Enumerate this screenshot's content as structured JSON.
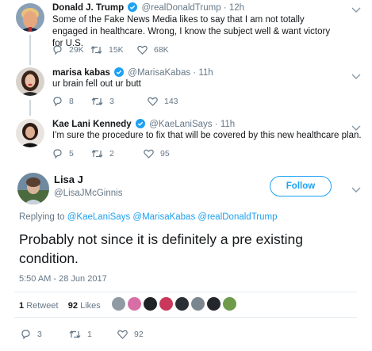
{
  "tweets": [
    {
      "name": "Donald J. Trump",
      "handle": "@realDonaldTrump",
      "dot": "·",
      "time": "12h",
      "text": "Some of the Fake News Media likes to say that I am not totally engaged in healthcare. Wrong, I know the subject well & want victory for U.S.",
      "replies": "29K",
      "retweets": "15K",
      "likes": "68K"
    },
    {
      "name": "marisa kabas",
      "handle": "@MarisaKabas",
      "dot": "·",
      "time": "11h",
      "text": "ur brain fell out ur butt",
      "replies": "8",
      "retweets": "3",
      "likes": "143"
    },
    {
      "name": "Kae Lani Kennedy",
      "handle": "@KaeLaniSays",
      "dot": "·",
      "time": "11h",
      "text": "I'm sure the procedure to fix that will be covered by this new healthcare plan.",
      "replies": "5",
      "retweets": "2",
      "likes": "95"
    }
  ],
  "focused": {
    "name": "Lisa J",
    "handle": "@LisaJMcGinnis",
    "follow_label": "Follow",
    "replying_prefix": "Replying to",
    "mentions": [
      "@KaeLaniSays",
      "@MarisaKabas",
      "@realDonaldTrump"
    ],
    "text": "Probably not since it is definitely a pre existing condition.",
    "timestamp": "5:50 AM - 28 Jun 2017",
    "retweet_count": "1",
    "retweet_label": "Retweet",
    "like_count": "92",
    "like_label": "Likes",
    "replies": "3",
    "retweets": "1",
    "likes": "92"
  },
  "colors": {
    "accent": "#1da1f2",
    "secondary_text": "#657786",
    "primary_text": "#14171a",
    "divider": "#e6ecf0"
  },
  "icons": {
    "reply": "reply-icon",
    "retweet": "retweet-icon",
    "like": "heart-icon",
    "verified": "verified-badge-icon",
    "menu": "chevron-down-icon"
  }
}
